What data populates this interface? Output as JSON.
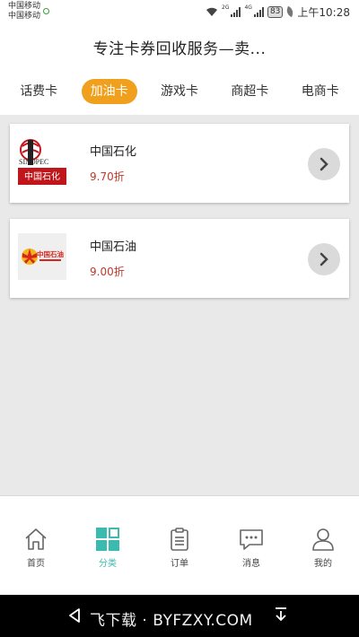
{
  "status_bar": {
    "carrier_line1": "中国移动",
    "carrier_line2": "中国移动",
    "net_label_1": "2G",
    "net_label_2": "4G",
    "battery": "83",
    "time": "上午10:28"
  },
  "header": {
    "title": "专注卡券回收服务—卖..."
  },
  "tabs": [
    {
      "label": "话费卡",
      "active": false
    },
    {
      "label": "加油卡",
      "active": true
    },
    {
      "label": "游戏卡",
      "active": false
    },
    {
      "label": "商超卡",
      "active": false
    },
    {
      "label": "电商卡",
      "active": false
    }
  ],
  "cards": [
    {
      "name": "中国石化",
      "discount": "9.70折",
      "logo_icon": "sinopec-logo",
      "logo_text": "中国石化",
      "logo_brand": "SINOPEC"
    },
    {
      "name": "中国石油",
      "discount": "9.00折",
      "logo_icon": "petrochina-logo",
      "logo_text": "中国石油"
    }
  ],
  "bottom_nav": [
    {
      "label": "首页",
      "icon": "home-icon",
      "active": false
    },
    {
      "label": "分类",
      "icon": "category-icon",
      "active": true
    },
    {
      "label": "订单",
      "icon": "clipboard-icon",
      "active": false
    },
    {
      "label": "消息",
      "icon": "message-icon",
      "active": false
    },
    {
      "label": "我的",
      "icon": "user-icon",
      "active": false
    }
  ],
  "system_nav": {
    "watermark": "飞下载 · BYFZXY.COM"
  },
  "colors": {
    "accent_orange": "#f0a01c",
    "accent_teal": "#3bbbb0",
    "discount_red": "#c0392b",
    "background": "#e9e9e9"
  }
}
